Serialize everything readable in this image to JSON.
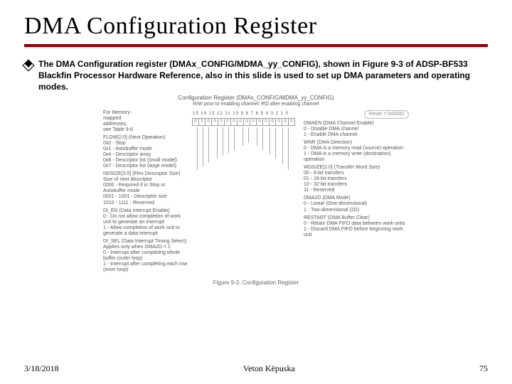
{
  "title": "DMA Configuration Register",
  "bullet": "The DMA Configuration register (DMAx_CONFIG/MDMA_yy_CONFIG), shown in Figure 9-3 of ADSP-BF533 Blackfin Processor Hardware Reference, also in this slide is used to set up DMA parameters and operating modes.",
  "fig": {
    "title": "Configuration Register (DMAx_CONFIG/MDMA_yy_CONFIG)",
    "subtitle": "R/W prior to enabling channel; RO after enabling channel",
    "bits_label": "15 14 13 12  11 10  9  8   7  6  5  4   3  2  1  0",
    "reset": "Reset = 0x0000",
    "left": {
      "mem": "For Memory-\nmapped\naddresses,\nsee Table 9-6",
      "flow_hd": "FLOW[2:0] (Next Operation)",
      "flow_items": "0x0 - Stop\n0x1 - Autobuffer mode\n0x4 - Descriptor array\n0x6 - Descriptor list (small model)\n0x7 - Descriptor list (large model)",
      "ndsize_hd": "NDSIZE[3:0] (Flex Descriptor Size)",
      "ndsize_sub": "Size of next descriptor",
      "ndsize_items": "0000 - Required if in Stop or Autobuffer mode\n0001 - 1001 - Descriptor size\n1010 - 1111 - Reserved",
      "dien_hd": "DI_EN (Data Interrupt Enable)",
      "dien_items": "0 - Do not allow completion of work unit to generate an interrupt\n1 - Allow completion of work unit to generate a data interrupt",
      "disel_hd": "DI_SEL (Data Interrupt Timing Select)",
      "disel_sub": "Applies only when DMA2D = 1",
      "disel_items": "0 - Interrupt after completing whole buffer (outer loop)\n1 - Interrupt after completing each row (inner loop)"
    },
    "right": {
      "dmaen_hd": "DMAEN (DMA Channel Enable)",
      "dmaen_items": "0 - Disable DMA channel\n1 - Enable DMA channel",
      "wnr_hd": "WNR (DMA Direction)",
      "wnr_items": "0 - DMA is a memory read (source) operation\n1 - DMA is a memory write (destination) operation",
      "wdsize_hd": "WDSIZE[1:0] (Transfer Word Size)",
      "wdsize_items": "00 - 8-bit transfers\n01 - 16-bit transfers\n10 - 32-bit transfers\n11 - Reserved",
      "dma2d_hd": "DMA2D (DMA Mode)",
      "dma2d_items": "0 - Linear (One-dimensional)\n1 - Two-dimensional (2D)",
      "restart_hd": "RESTART (DMA Buffer Clear)",
      "restart_items": "0 - Retain DMA FIFO data between work units\n1 - Discard DMA FIFO before beginning work unit"
    },
    "caption": "Figure 9-3. Configuration Register"
  },
  "footer": {
    "date": "3/18/2018",
    "author": "Veton Këpuska",
    "page": "75"
  }
}
